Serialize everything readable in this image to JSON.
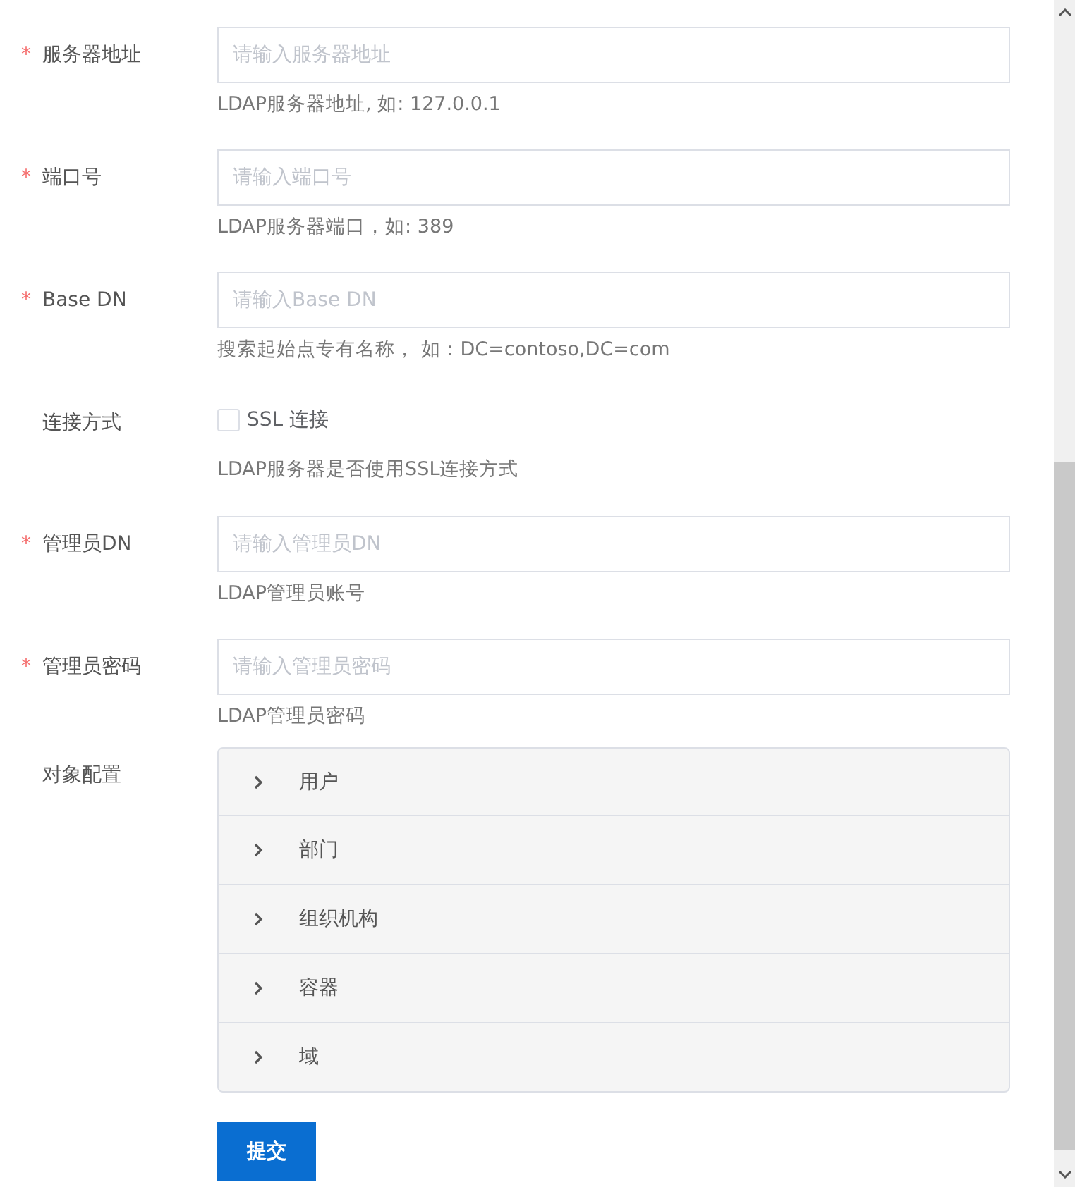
{
  "fields": [
    {
      "kind": "input",
      "label": "服务器地址",
      "required_mark": "*",
      "placeholder": "请输入服务器地址",
      "help": "LDAP服务器地址, 如: 127.0.0.1"
    },
    {
      "kind": "input",
      "label": "端口号",
      "required_mark": "*",
      "placeholder": "请输入端口号",
      "help": "LDAP服务器端口，如: 389"
    },
    {
      "kind": "input",
      "label": "Base DN",
      "required_mark": "*",
      "placeholder": "请输入Base DN",
      "help": "搜索起始点专有名称， 如：DC=contoso,DC=com"
    },
    {
      "kind": "checkbox",
      "label": "连接方式",
      "option": "SSL 连接",
      "checked": false,
      "help": "LDAP服务器是否使用SSL连接方式"
    },
    {
      "kind": "input",
      "label": "管理员DN",
      "required_mark": "*",
      "placeholder": "请输入管理员DN",
      "help": "LDAP管理员账号"
    },
    {
      "kind": "input",
      "label": "管理员密码",
      "required_mark": "*",
      "placeholder": "请输入管理员密码",
      "help": "LDAP管理员密码"
    },
    {
      "kind": "collapse",
      "label": "对象配置",
      "panels": [
        {
          "title": "用户",
          "expanded": false
        },
        {
          "title": "部门",
          "expanded": false
        },
        {
          "title": "组织机构",
          "expanded": false
        },
        {
          "title": "容器",
          "expanded": false
        },
        {
          "title": "域",
          "expanded": false
        }
      ]
    }
  ],
  "submit": "提交"
}
